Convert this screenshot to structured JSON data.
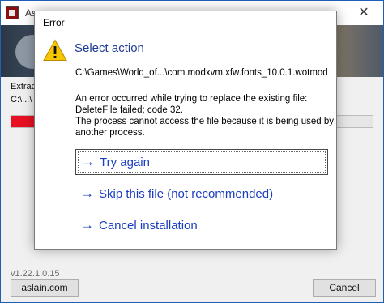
{
  "background_window": {
    "title": "As",
    "close_glyph": "✕",
    "extract_label": "Extract",
    "path_label": "C:\\...\\",
    "progress": {
      "fraction": 0.11,
      "color": "#e81123"
    },
    "version": "v1.22.1.0.15",
    "site_button": "aslain.com",
    "cancel_button": "Cancel"
  },
  "dialog": {
    "title": "Error",
    "icon": "warning-icon",
    "instruction": "Select action",
    "file_path": "C:\\Games\\World_of...\\com.modxvm.xfw.fonts_10.0.1.wotmod",
    "message_lines": [
      "An error occurred while trying to replace the existing file:",
      "DeleteFile failed; code 32.",
      "The process cannot access the file because it is being used by",
      "another process."
    ],
    "commands": [
      {
        "arrow": "→",
        "label": "Try again"
      },
      {
        "arrow": "→",
        "label": "Skip this file (not recommended)"
      },
      {
        "arrow": "→",
        "label": "Cancel installation"
      }
    ],
    "colors": {
      "instruction": "#1f3a94",
      "link": "#1a3ec0",
      "warning": "#f7c600"
    }
  }
}
